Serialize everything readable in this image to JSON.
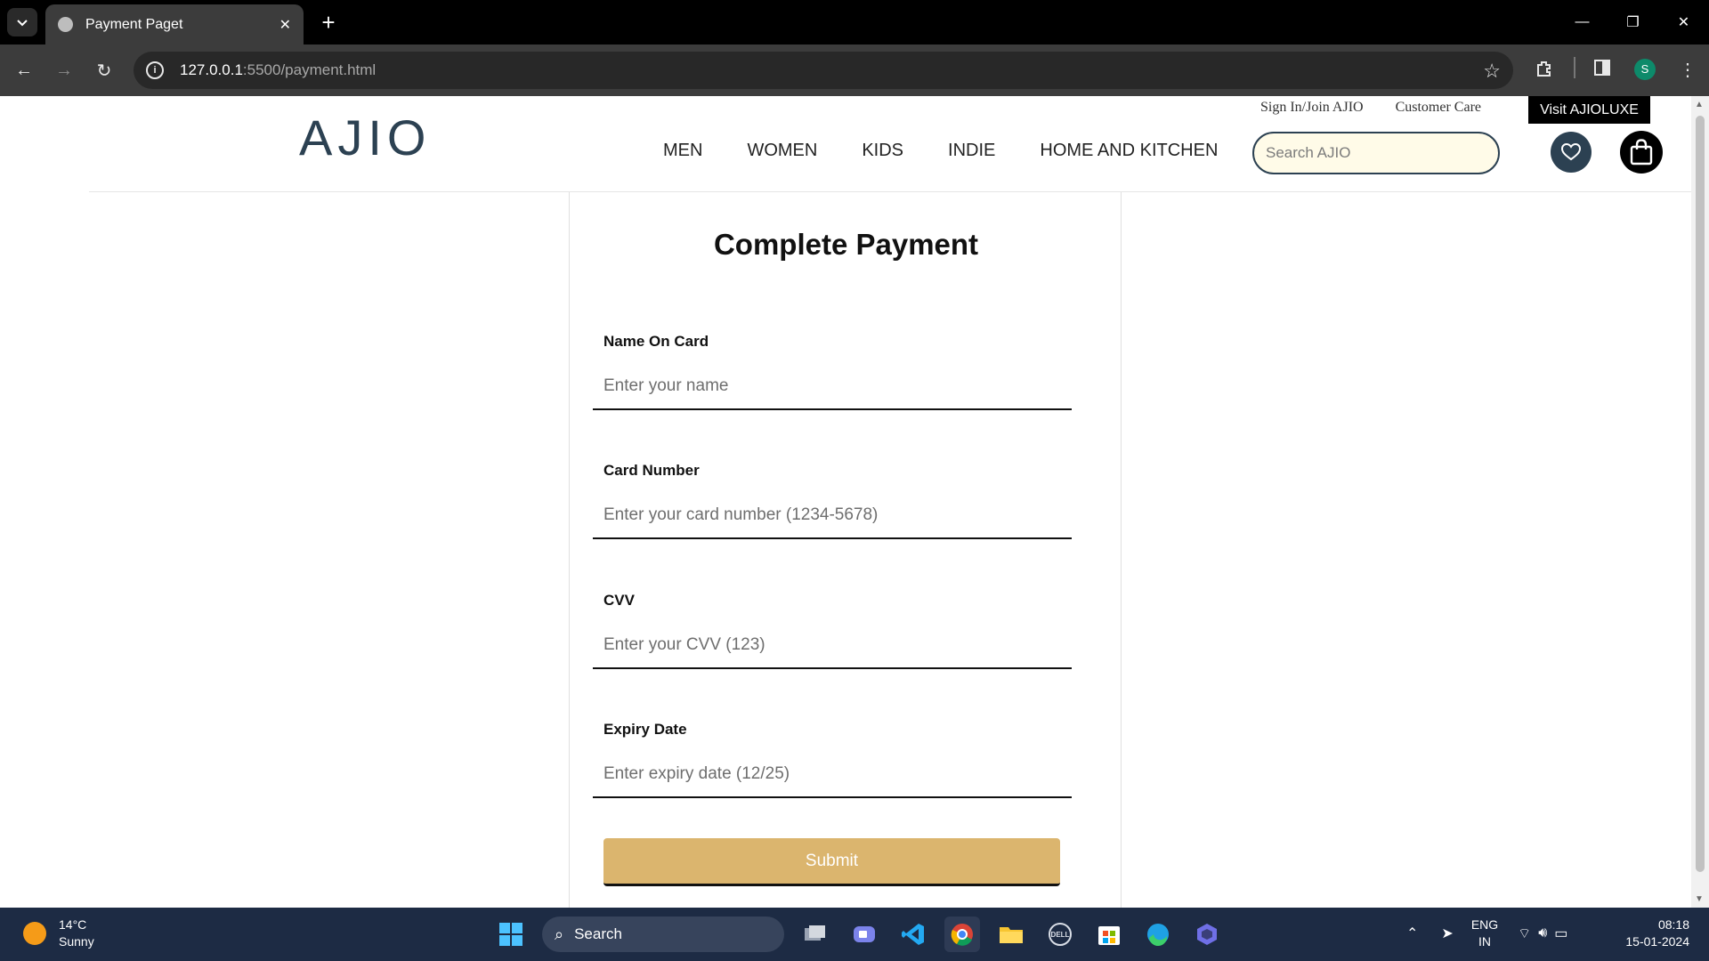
{
  "browser": {
    "tab_title": "Payment Paget",
    "url_host": "127.0.0.1",
    "url_path": ":5500/payment.html",
    "profile_initial": "S"
  },
  "site": {
    "logo": "AJIO",
    "top_links": [
      "Sign In/Join AJIO",
      "Customer Care"
    ],
    "luxe_button": "Visit AJIOLUXE",
    "nav": [
      "MEN",
      "WOMEN",
      "KIDS",
      "INDIE",
      "HOME AND KITCHEN"
    ],
    "search_placeholder": "Search AJIO"
  },
  "payment": {
    "title": "Complete Payment",
    "fields": [
      {
        "label": "Name On Card",
        "placeholder": "Enter your name"
      },
      {
        "label": "Card Number",
        "placeholder": "Enter your card number (1234-5678)"
      },
      {
        "label": "CVV",
        "placeholder": "Enter your CVV (123)"
      },
      {
        "label": "Expiry Date",
        "placeholder": "Enter expiry date (12/25)"
      }
    ],
    "submit_label": "Submit"
  },
  "taskbar": {
    "weather_temp": "14°C",
    "weather_desc": "Sunny",
    "search_label": "Search",
    "lang_top": "ENG",
    "lang_bottom": "IN",
    "time": "08:18",
    "date": "15-01-2024"
  }
}
